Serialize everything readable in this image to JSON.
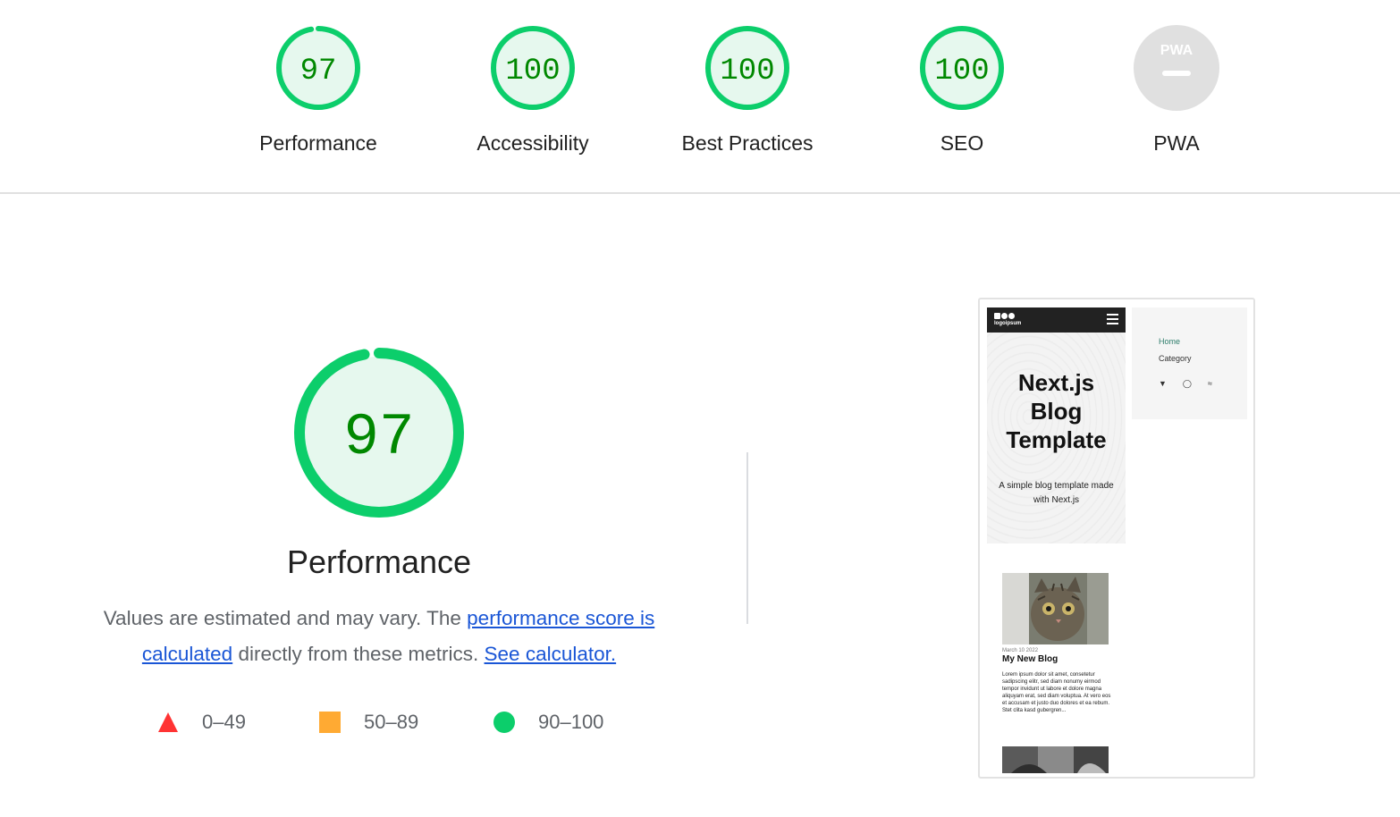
{
  "categories": [
    {
      "label": "Performance",
      "score": "97",
      "score_fraction": 0.97
    },
    {
      "label": "Accessibility",
      "score": "100",
      "score_fraction": 1.0
    },
    {
      "label": "Best Practices",
      "score": "100",
      "score_fraction": 1.0
    },
    {
      "label": "SEO",
      "score": "100",
      "score_fraction": 1.0
    },
    {
      "label": "PWA",
      "score": "",
      "pwa_badge": "PWA"
    }
  ],
  "performance": {
    "score": "97",
    "score_fraction": 0.97,
    "title": "Performance",
    "desc_prefix": "Values are estimated and may vary. The ",
    "desc_link1": "performance score is calculated",
    "desc_middle": " directly from these metrics. ",
    "desc_link2": "See calculator."
  },
  "legend": [
    {
      "range": "0–49",
      "shape": "triangle",
      "color": "#ff3333"
    },
    {
      "range": "50–89",
      "shape": "square",
      "color": "#ffaa33"
    },
    {
      "range": "90–100",
      "shape": "circle",
      "color": "#0cce6b"
    }
  ],
  "colors": {
    "pass": "#0cce6b",
    "pass_text": "#008800",
    "pass_fill": "#e6f8ee",
    "na": "#e0e0e0",
    "link": "#1a56d6"
  },
  "screenshot": {
    "logo_text": "logoipsum",
    "hero_title_line1": "Next.js",
    "hero_title_line2": "Blog",
    "hero_title_line3": "Template",
    "hero_subtitle": "A simple blog template made with Next.js",
    "menu_home": "Home",
    "menu_category": "Category",
    "post_date": "March 10 2022",
    "post_title": "My New Blog",
    "post_excerpt": "Lorem ipsum dolor sit amet, consetetur sadipscing elitr, sed diam nonumy eirmod tempor invidunt ut labore et dolore magna aliquyam erat, sed diam voluptua. At vero eos et accusam et justo duo dolores et ea rebum. Stet clita kasd gubergren..."
  }
}
